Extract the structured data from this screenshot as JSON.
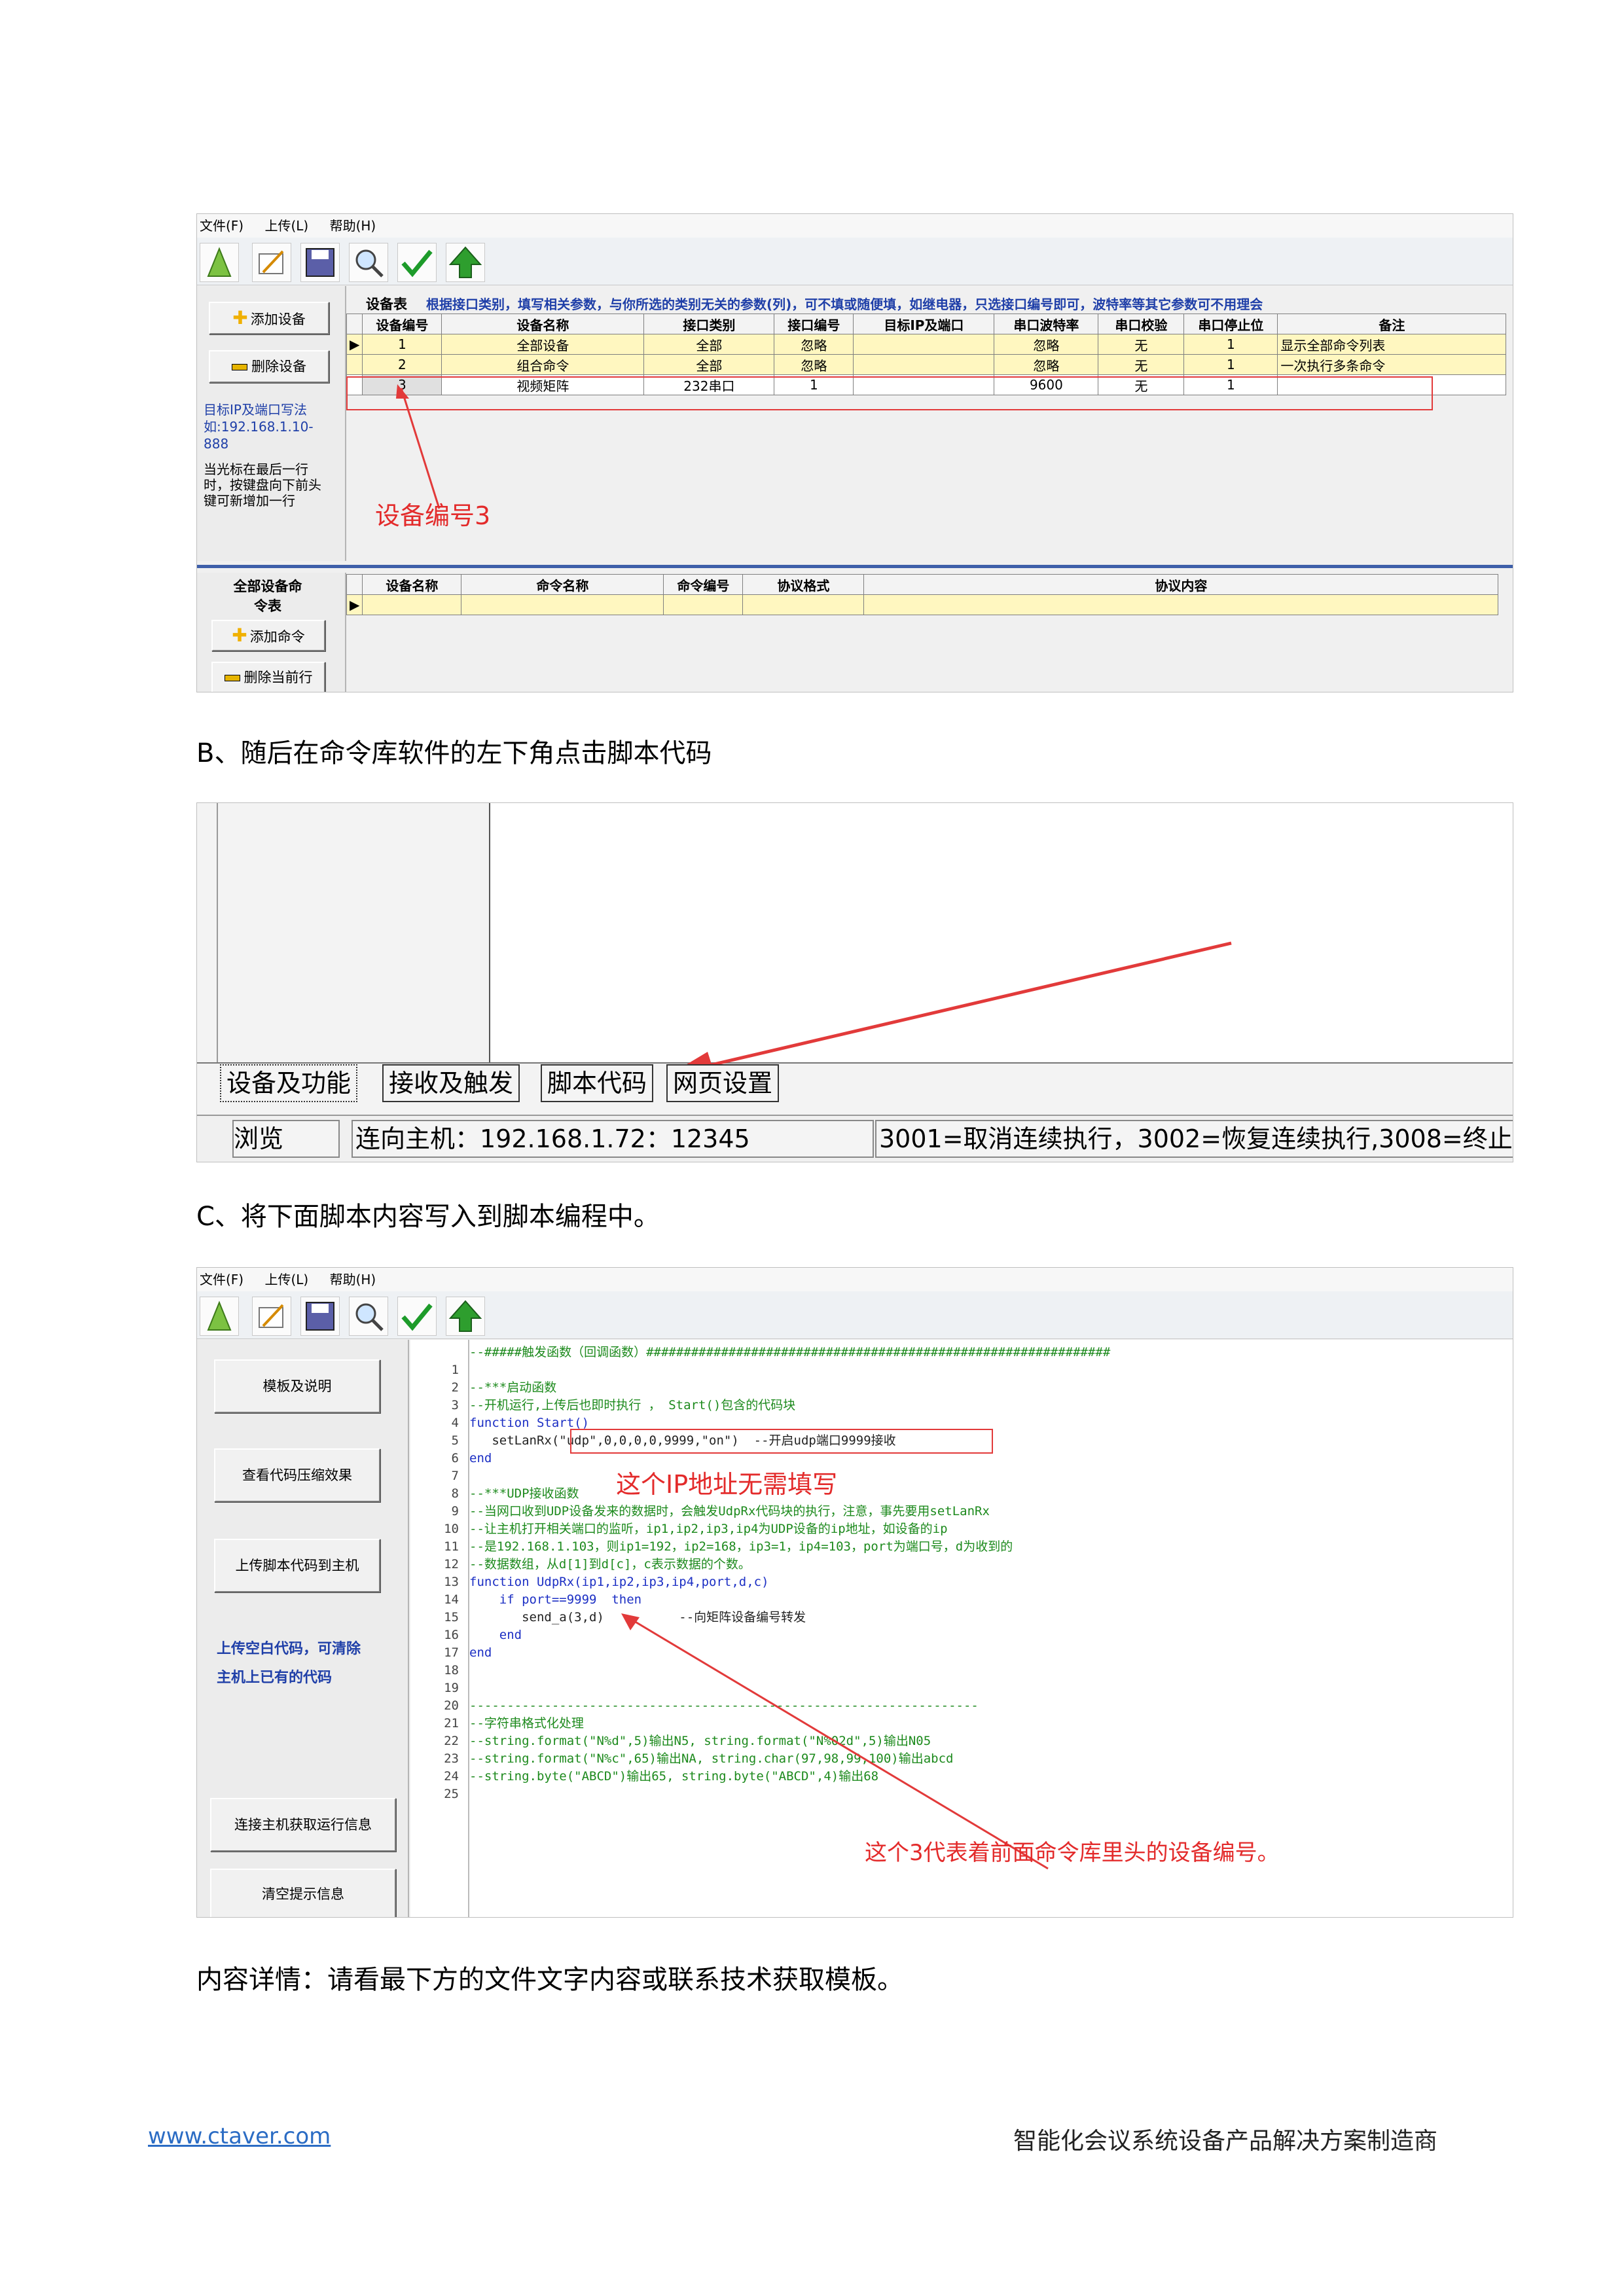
{
  "window1": {
    "menu": [
      "文件(F)",
      "上传(L)",
      "帮助(H)"
    ],
    "device_table_label": "设备表",
    "device_table_hint": "根据接口类别，填写相关参数，与你所选的类别无关的参数(列)，可不填或随便填，如继电器，只选接口编号即可，波特率等其它参数可不用理会",
    "add_device": "添加设备",
    "delete_device": "删除设备",
    "ip_hint": "目标IP及端口写法如:192.168.1.10-888",
    "cursor_hint": "当光标在最后一行时，按键盘向下前头键可新增加一行",
    "device_columns": [
      "设备编号",
      "设备名称",
      "接口类别",
      "接口编号",
      "目标IP及端口",
      "串口波特率",
      "串口校验",
      "串口停止位",
      "备注"
    ],
    "device_rows": [
      [
        "1",
        "全部设备",
        "全部",
        "忽略",
        "",
        "忽略",
        "无",
        "1",
        "显示全部命令列表"
      ],
      [
        "2",
        "组合命令",
        "全部",
        "忽略",
        "",
        "忽略",
        "无",
        "1",
        "一次执行多条命令"
      ],
      [
        "3",
        "视频矩阵",
        "232串口",
        "1",
        "",
        "9600",
        "无",
        "1",
        ""
      ]
    ],
    "annotation": "设备编号3",
    "command_table_label": "全部设备命令表",
    "add_command": "添加命令",
    "delete_row": "删除当前行",
    "command_columns": [
      "设备名称",
      "命令名称",
      "命令编号",
      "协议格式",
      "协议内容"
    ]
  },
  "heading_b": "B、随后在命令库软件的左下角点击脚本代码",
  "window2": {
    "tabs": [
      "设备及功能",
      "接收及触发",
      "脚本代码",
      "网页设置"
    ],
    "status_browse": "浏览",
    "status_host": "连向主机：192.168.1.72：12345",
    "status_codes": "3001=取消连续执行，3002=恢复连续执行,3008=终止"
  },
  "heading_c": "C、将下面脚本内容写入到脚本编程中。",
  "window3": {
    "menu": [
      "文件(F)",
      "上传(L)",
      "帮助(H)"
    ],
    "buttons": [
      "模板及说明",
      "查看代码压缩效果",
      "上传脚本代码到主机",
      "连接主机获取运行信息",
      "清空提示信息"
    ],
    "upload_hint_1": "上传空白代码，可清除",
    "upload_hint_2": "主机上已有的代码",
    "code_lines": [
      "--#####触发函数（回调函数）##############################################################",
      "",
      "--***启动函数",
      "--开机运行,上传后也即时执行 ， Start()包含的代码块",
      "function Start()",
      "   setLanRx(\"udp\",0,0,0,0,9999,\"on\")  --开启udp端口9999接收",
      "end",
      "",
      "--***UDP接收函数",
      "--当网口收到UDP设备发来的数据时，会触发UdpRx代码块的执行，注意，事先要用setLanRx",
      "--让主机打开相关端口的监听，ip1,ip2,ip3,ip4为UDP设备的ip地址，如设备的ip",
      "--是192.168.1.103，则ip1=192，ip2=168，ip3=1，ip4=103，port为端口号，d为收到的",
      "--数据数组，从d[1]到d[c]，c表示数据的个数。",
      "function UdpRx(ip1,ip2,ip3,ip4,port,d,c)",
      "    if port==9999  then",
      "       send_a(3,d)          --向矩阵设备编号转发",
      "    end",
      "end",
      "",
      "",
      "--------------------------------------------------------------------",
      "--字符串格式化处理",
      "--string.format(\"N%d\",5)输出N5, string.format(\"N%02d\",5)输出N05",
      "--string.format(\"N%c\",65)输出NA, string.char(97,98,99,100)输出abcd",
      "--string.byte(\"ABCD\")输出65, string.byte(\"ABCD\",4)输出68"
    ],
    "annotation_ip": "这个IP地址无需填写",
    "annotation_device": "这个3代表着前面命令库里头的设备编号。"
  },
  "details": "内容详情：请看最下方的文件文字内容或联系技术获取模板。",
  "footer": {
    "url": "www.ctaver.com",
    "slogan": "智能化会议系统设备产品解决方案制造商"
  },
  "colors": {
    "annotation_red": "#e32b2b",
    "code_comment_green": "#1d8a1d",
    "keyword_blue": "#1c2fc4",
    "hint_blue": "#1f3fa8",
    "row_highlight": "#fff7c0",
    "link_blue": "#2b6cc4"
  }
}
